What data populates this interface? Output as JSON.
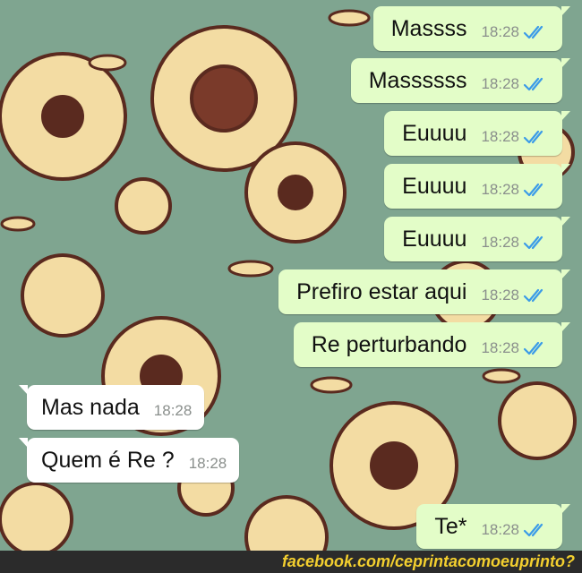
{
  "colors": {
    "wallpaper_green": "#7fa590",
    "flower_cream": "#f3dca3",
    "flower_brown": "#5a2a1f",
    "outgoing_bubble": "#e3fdc8",
    "incoming_bubble": "#ffffff",
    "read_ticks": "#3b9be8",
    "footer_text": "#f3cf2f"
  },
  "messages": [
    {
      "direction": "out",
      "text": "Massss",
      "time": "18:28",
      "status": "read-double-tick-icon"
    },
    {
      "direction": "out",
      "text": "Massssss",
      "time": "18:28",
      "status": "read-double-tick-icon"
    },
    {
      "direction": "out",
      "text": "Euuuu",
      "time": "18:28",
      "status": "read-double-tick-icon"
    },
    {
      "direction": "out",
      "text": "Euuuu",
      "time": "18:28",
      "status": "read-double-tick-icon"
    },
    {
      "direction": "out",
      "text": "Euuuu",
      "time": "18:28",
      "status": "read-double-tick-icon"
    },
    {
      "direction": "out",
      "text": "Prefiro estar aqui",
      "time": "18:28",
      "status": "read-double-tick-icon"
    },
    {
      "direction": "out",
      "text": "Re perturbando",
      "time": "18:28",
      "status": "read-double-tick-icon"
    },
    {
      "direction": "in",
      "text": "Mas nada",
      "time": "18:28"
    },
    {
      "direction": "in",
      "text": "Quem é Re ?",
      "time": "18:28"
    },
    {
      "direction": "out",
      "text": "Te*",
      "time": "18:28",
      "status": "read-double-tick-icon"
    }
  ],
  "footer": {
    "credit": "facebook.com/ceprintacomoeuprinto?"
  }
}
